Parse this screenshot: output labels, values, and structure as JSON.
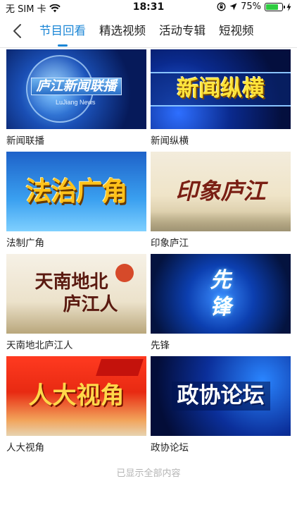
{
  "status_bar": {
    "carrier": "无 SIM 卡",
    "time": "18:31",
    "battery_percent": "75%",
    "battery_level": 0.75
  },
  "nav": {
    "tabs": [
      {
        "label": "节目回看",
        "active": true
      },
      {
        "label": "精选视频",
        "active": false
      },
      {
        "label": "活动专辑",
        "active": false
      },
      {
        "label": "短视频",
        "active": false
      }
    ],
    "accent_color": "#1b86d6"
  },
  "programs": [
    {
      "title": "新闻联播",
      "thumb_text": "庐江新闻联播",
      "thumb_sub": "LuJiang News"
    },
    {
      "title": "新闻纵横",
      "thumb_text": "新闻纵横"
    },
    {
      "title": "法制广角",
      "thumb_text": "法治广角"
    },
    {
      "title": "印象庐江",
      "thumb_text": "印象庐江"
    },
    {
      "title": "天南地北庐江人",
      "thumb_text": "天南地北",
      "thumb_text2": "庐江人"
    },
    {
      "title": "先锋",
      "thumb_text": "先",
      "thumb_text2": "锋"
    },
    {
      "title": "人大视角",
      "thumb_text": "人大视角"
    },
    {
      "title": "政协论坛",
      "thumb_text": "政协论坛"
    }
  ],
  "footer": {
    "end_text": "已显示全部内容"
  }
}
